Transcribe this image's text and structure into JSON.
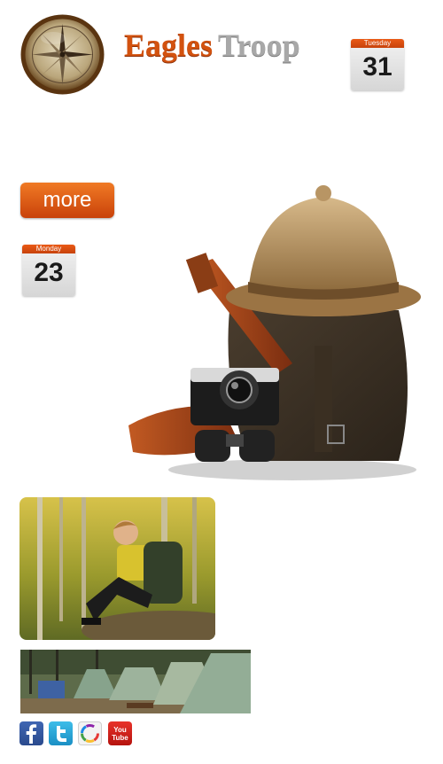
{
  "header": {
    "title_part1": "Eagles",
    "title_part2": "Troop"
  },
  "calendar_top": {
    "weekday": "Tuesday",
    "day": "31"
  },
  "calendar_mid": {
    "weekday": "Monday",
    "day": "23"
  },
  "more_button": {
    "label": "more"
  },
  "social": {
    "youtube_line1": "You",
    "youtube_line2": "Tube"
  },
  "colors": {
    "accent_orange": "#d3520f",
    "title_grey": "#a8a8a8",
    "facebook_blue": "#3b5998",
    "twitter_blue": "#2aa9e0",
    "youtube_red": "#d42a22"
  },
  "icons": [
    "compass-logo",
    "facebook-icon",
    "twitter-icon",
    "picasa-icon",
    "youtube-icon"
  ]
}
